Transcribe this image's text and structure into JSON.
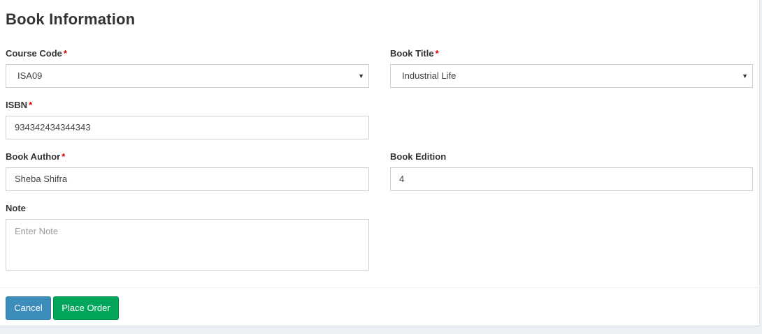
{
  "form": {
    "title": "Book Information",
    "required_mark": "*",
    "course_code": {
      "label": "Course Code",
      "value": "ISA09"
    },
    "book_title": {
      "label": "Book Title",
      "value": "Industrial Life"
    },
    "isbn": {
      "label": "ISBN",
      "value": "934342434344343"
    },
    "book_author": {
      "label": "Book Author",
      "value": "Sheba Shifra"
    },
    "book_edition": {
      "label": "Book Edition",
      "value": "4"
    },
    "note": {
      "label": "Note",
      "placeholder": "Enter Note",
      "value": ""
    }
  },
  "footer": {
    "cancel_label": "Cancel",
    "place_order_label": "Place Order"
  },
  "icons": {
    "dropdown": "caret-down-icon"
  },
  "colors": {
    "cancel_button": "#3c8dbc",
    "place_order_button": "#00a65a",
    "required_mark": "#dd0000"
  }
}
